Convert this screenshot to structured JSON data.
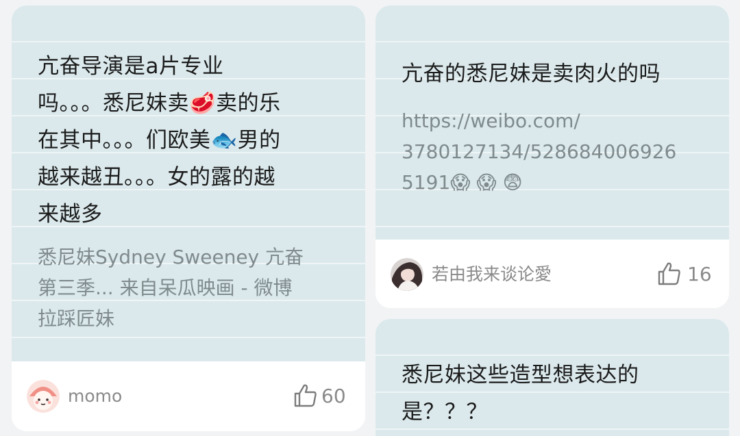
{
  "cards": [
    {
      "title_lines": [
        "亢奋导演是a片专业",
        "吗。。。悉尼妹卖🥩卖的乐",
        "在其中。。。们欧美🐟男的",
        "越来越丑。。。女的露的越",
        "来越多"
      ],
      "subtitle_lines": [
        "悉尼妹Sydney Sweeney 亢奋",
        "第三季... 来自呆瓜映画 - 微博",
        "拉踩匠妹"
      ],
      "author": "momo",
      "likes": "60",
      "avatar_icon": "cartoon-face-avatar",
      "like_icon": "thumbs-up-icon"
    },
    {
      "title_lines": [
        "亢奋的悉尼妹是卖肉火的吗"
      ],
      "subtitle_lines": [
        "https://weibo.com/",
        "3780127134/528684006926",
        "5191😱 😱 😨"
      ],
      "author": "若由我来谈论愛",
      "likes": "16",
      "avatar_icon": "photo-avatar",
      "like_icon": "thumbs-up-icon"
    },
    {
      "title_lines": [
        "悉尼妹这些造型想表达的",
        "是？？？"
      ]
    }
  ],
  "colors": {
    "card_body": "#dbe9ec",
    "page_bg": "#f2f3f5",
    "title_text": "#1b1b1b",
    "sub_text": "#7f8a8d",
    "meta_text": "#8a8a8a"
  }
}
